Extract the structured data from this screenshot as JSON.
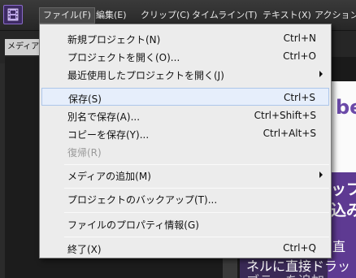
{
  "menubar": {
    "items": [
      {
        "label": "ファイル(F)",
        "active": true
      },
      {
        "label": "編集(E)"
      },
      {
        "label": "クリップ(C)"
      },
      {
        "label": "タイムライン(T)"
      },
      {
        "label": "テキスト(X)"
      },
      {
        "label": "アクション/"
      }
    ]
  },
  "panel": {
    "tab_label": "メディアオ"
  },
  "preview": {
    "brand_text": "be",
    "heading_1": "ップ",
    "heading_2": "込み",
    "line_1": "は、直",
    "line_2": "ネルに直接ドラッ",
    "line_3": "ブラ…を追加"
  },
  "file_menu": {
    "items": [
      {
        "label": "新規プロジェクト(N)",
        "shortcut": "Ctrl+N"
      },
      {
        "label": "プロジェクトを開く(O)...",
        "shortcut": "Ctrl+O"
      },
      {
        "label": "最近使用したプロジェクトを開く(J)",
        "shortcut": ""
      },
      {
        "label": "保存(S)",
        "shortcut": "Ctrl+S"
      },
      {
        "label": "別名で保存(A)...",
        "shortcut": "Ctrl+Shift+S"
      },
      {
        "label": "コピーを保存(Y)...",
        "shortcut": "Ctrl+Alt+S"
      },
      {
        "label": "復帰(R)",
        "shortcut": ""
      },
      {
        "label": "メディアの追加(M)",
        "shortcut": ""
      },
      {
        "label": "プロジェクトのバックアップ(T)...",
        "shortcut": ""
      },
      {
        "label": "ファイルのプロパティ情報(G)",
        "shortcut": ""
      },
      {
        "label": "終了(X)",
        "shortcut": "Ctrl+Q"
      }
    ]
  },
  "colors": {
    "highlight_bg": "#e6eefb",
    "highlight_border": "#adc6ea",
    "brand_purple": "#5e3a92"
  }
}
